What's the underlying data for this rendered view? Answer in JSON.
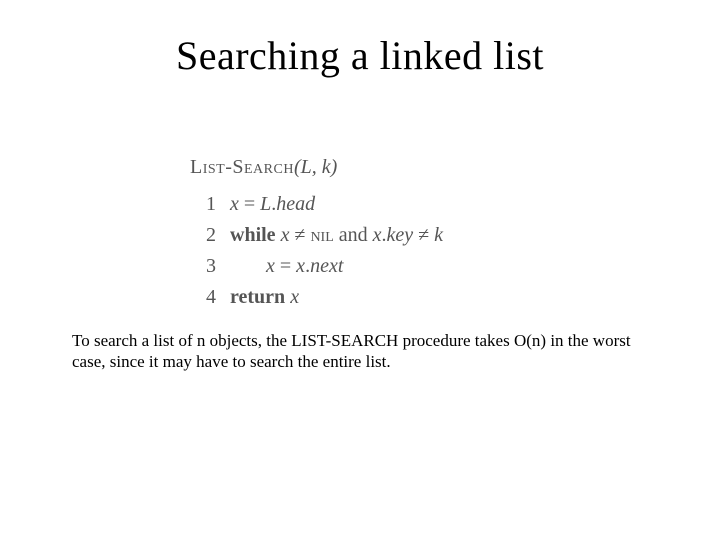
{
  "title": "Searching a linked list",
  "proc": {
    "name": "List-Search",
    "args": "(L, k)"
  },
  "lines": {
    "l1": {
      "num": "1",
      "lhs": "x",
      "eq": " = ",
      "rhs_obj": "L",
      "dot": ".",
      "rhs_attr": "head"
    },
    "l2": {
      "num": "2",
      "kw": "while",
      "sp": " ",
      "v1": "x",
      "neq": " ≠ ",
      "nil": "nil",
      "and": " and ",
      "v2": "x",
      "dot": ".",
      "attr": "key",
      "neq2": " ≠ ",
      "v3": "k"
    },
    "l3": {
      "num": "3",
      "lhs": "x",
      "eq": " = ",
      "rhs_obj": "x",
      "dot": ".",
      "rhs_attr": "next"
    },
    "l4": {
      "num": "4",
      "kw": "return",
      "sp": " ",
      "v": "x"
    }
  },
  "paragraph": "To search a list of n objects, the LIST-SEARCH procedure takes O(n) in the worst case, since it may have to search the entire list."
}
